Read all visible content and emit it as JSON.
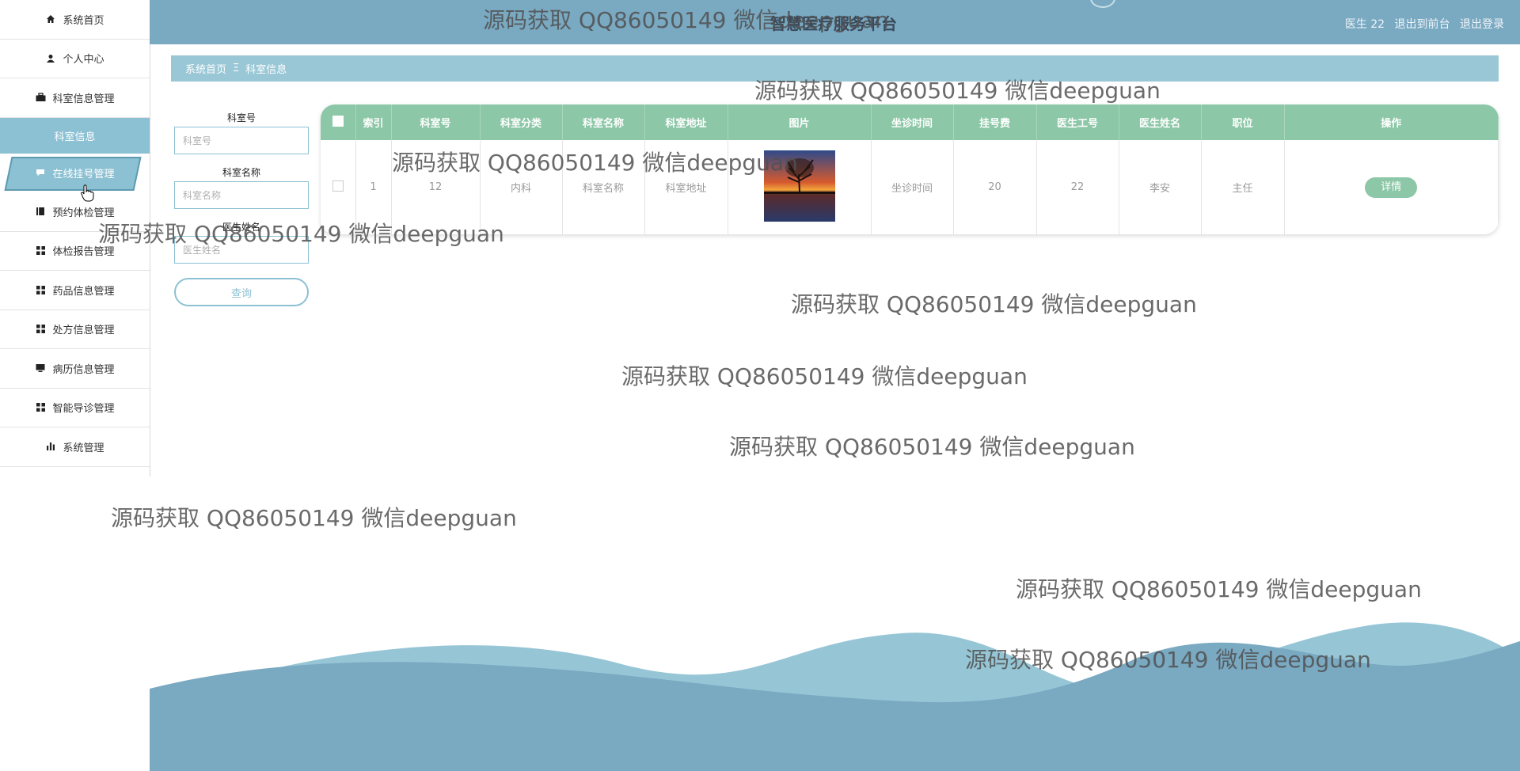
{
  "app": {
    "title": "智慧医疗服务平台"
  },
  "header": {
    "user_label": "医生 22",
    "back_label": "退出到前台",
    "logout_label": "退出登录"
  },
  "sidebar": {
    "items": [
      {
        "label": "系统首页",
        "icon": "home-icon"
      },
      {
        "label": "个人中心",
        "icon": "user-icon"
      },
      {
        "label": "科室信息管理",
        "icon": "briefcase-icon"
      },
      {
        "label": "科室信息",
        "icon": ""
      },
      {
        "label": "在线挂号管理",
        "icon": "comment-icon"
      },
      {
        "label": "预约体检管理",
        "icon": "book-icon"
      },
      {
        "label": "体检报告管理",
        "icon": "grid-icon"
      },
      {
        "label": "药品信息管理",
        "icon": "grid-icon"
      },
      {
        "label": "处方信息管理",
        "icon": "grid-icon"
      },
      {
        "label": "病历信息管理",
        "icon": "monitor-icon"
      },
      {
        "label": "智能导诊管理",
        "icon": "grid-icon"
      },
      {
        "label": "系统管理",
        "icon": "bar-chart-icon"
      }
    ]
  },
  "breadcrumb": {
    "home": "系统首页",
    "separator": "Ξ",
    "current": "科室信息"
  },
  "search": {
    "fields": [
      {
        "label": "科室号",
        "placeholder": "科室号"
      },
      {
        "label": "科室名称",
        "placeholder": "科室名称"
      },
      {
        "label": "医生姓名",
        "placeholder": "医生姓名"
      }
    ],
    "button": "查询"
  },
  "table": {
    "headers": [
      "索引",
      "科室号",
      "科室分类",
      "科室名称",
      "科室地址",
      "图片",
      "坐诊时间",
      "挂号费",
      "医生工号",
      "医生姓名",
      "职位",
      "操作"
    ],
    "rows": [
      {
        "index": "1",
        "dept_no": "12",
        "category": "内科",
        "name": "科室名称",
        "address": "科室地址",
        "time": "坐诊时间",
        "fee": "20",
        "doctor_no": "22",
        "doctor_name": "李安",
        "position": "主任",
        "action": "详情"
      }
    ]
  },
  "watermark": "源码获取 QQ86050149 微信deepguan",
  "colors": {
    "header": "#7aa9c2",
    "accent": "#8cc0d3",
    "table_header": "#8cc7a7"
  }
}
